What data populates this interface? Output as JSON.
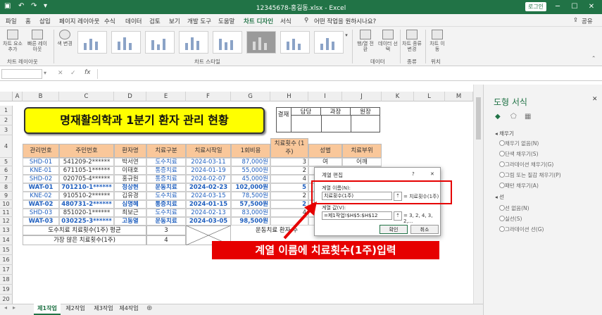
{
  "window": {
    "title": "12345678-홍길동.xlsx - Excel",
    "login_label": "로그인",
    "minimize": "─",
    "restore": "☐",
    "close": "✕"
  },
  "menu": {
    "items": [
      "파일",
      "홈",
      "삽입",
      "페이지 레이아웃",
      "수식",
      "데이터",
      "검토",
      "보기",
      "개발 도구",
      "도움말",
      "차트 디자인",
      "서식"
    ],
    "active_index": 10,
    "tell_me": "어떤 작업을 원하시나요?",
    "share": "공유"
  },
  "ribbon": {
    "add_element": "차트 요소 추가",
    "quick_layout": "빠른 레이아웃",
    "change_colors": "색 변경",
    "switch_row_col": "행/열 전환",
    "select_data": "데이터 선택",
    "change_chart_type": "차트 종류 변경",
    "move_chart": "차트 이동",
    "groups": {
      "layout": "차트 레이아웃",
      "styles": "차트 스타일",
      "data": "데이터",
      "type": "종류",
      "location": "위치"
    }
  },
  "formula_bar": {
    "name_box": "",
    "cancel": "✕",
    "enter": "✓",
    "fx": "fx",
    "content": ""
  },
  "sheet": {
    "columns": [
      "A",
      "B",
      "C",
      "D",
      "E",
      "F",
      "G",
      "H",
      "I",
      "J",
      "K",
      "L",
      "M"
    ],
    "rows": [
      "1",
      "2",
      "3",
      "4",
      "5",
      "6",
      "7",
      "8",
      "9",
      "10",
      "11",
      "12",
      "13",
      "14",
      "15",
      "16",
      "17",
      "18",
      "19",
      "20"
    ],
    "title": "명재활의학과 1분기 환자 관리 현황",
    "approval": {
      "side": "결재",
      "h1": "담당",
      "h2": "과장",
      "h3": "원장"
    },
    "headers": [
      "관리번호",
      "주민번호",
      "환자명",
      "치료구분",
      "치료시작일",
      "1회비용",
      "치료횟수 (1주)",
      "성별",
      "치료부위"
    ],
    "data_rows": [
      [
        "SHD-01",
        "541209-2******",
        "박서연",
        "도수치료",
        "2024-03-11",
        "87,000원",
        "3",
        "여",
        "어깨"
      ],
      [
        "KNE-01",
        "671105-1******",
        "이태호",
        "통증치료",
        "2024-01-19",
        "55,000원",
        "2",
        "",
        ""
      ],
      [
        "SHD-02",
        "020705-4******",
        "홍규원",
        "통증치료",
        "2024-02-07",
        "45,000원",
        "4",
        "",
        ""
      ],
      [
        "WAT-01",
        "701210-1******",
        "정상현",
        "운동치료",
        "2024-02-23",
        "102,000원",
        "5",
        "",
        ""
      ],
      [
        "KNE-02",
        "910510-2******",
        "김유경",
        "도수치료",
        "2024-03-15",
        "78,500원",
        "2",
        "",
        ""
      ],
      [
        "WAT-02",
        "480731-2******",
        "심명혜",
        "통증치료",
        "2024-01-15",
        "57,500원",
        "2",
        "",
        ""
      ],
      [
        "SHD-03",
        "851020-1******",
        "최보근",
        "도수치료",
        "2024-02-13",
        "83,000원",
        "4",
        "",
        ""
      ],
      [
        "WAT-03",
        "030225-3******",
        "고동열",
        "운동치료",
        "2024-03-05",
        "98,500원",
        "",
        "",
        ""
      ]
    ],
    "row13_label": "도수치료 치료횟수(1주) 평균",
    "row13_value": "3",
    "row13_right": "운동치료 환자 수",
    "row14_label": "가장 많은 치료횟수(1주)",
    "row14_value": "4"
  },
  "sheet_tabs": [
    "제1작업",
    "제2작업",
    "제3작업",
    "제4작업"
  ],
  "sheet_tab_active": 0,
  "dialog": {
    "title": "계열 편집",
    "help": "?",
    "close": "✕",
    "name_label": "계열 이름(N):",
    "name_value": "치료횟수(1주)",
    "name_preview": "= 치료횟수(1주)",
    "values_label": "계열 값(V):",
    "values_value": "=제1작업!$H$5:$H$12",
    "values_preview": "= 3, 2, 4, 3, 2,...",
    "ok": "확인",
    "cancel": "취소"
  },
  "callout": {
    "text": "계열 이름에 치료횟수(1주)입력"
  },
  "pane": {
    "title": "도형 서식",
    "close": "✕",
    "fill_section": "채우기",
    "fill_options": [
      "채우기 없음(N)",
      "단색 채우기(S)",
      "그라데이션 채우기(G)",
      "그림 또는 질감 채우기(P)",
      "패턴 채우기(A)"
    ],
    "line_section": "선",
    "line_options": [
      "선 없음(N)",
      "실선(S)",
      "그라데이션 선(G)"
    ]
  },
  "colors": {
    "accent": "#217346",
    "title_fill": "#ffff00",
    "header_fill": "#f9c79a",
    "highlight": "#e60000",
    "link_blue": "#1f5fbf"
  }
}
